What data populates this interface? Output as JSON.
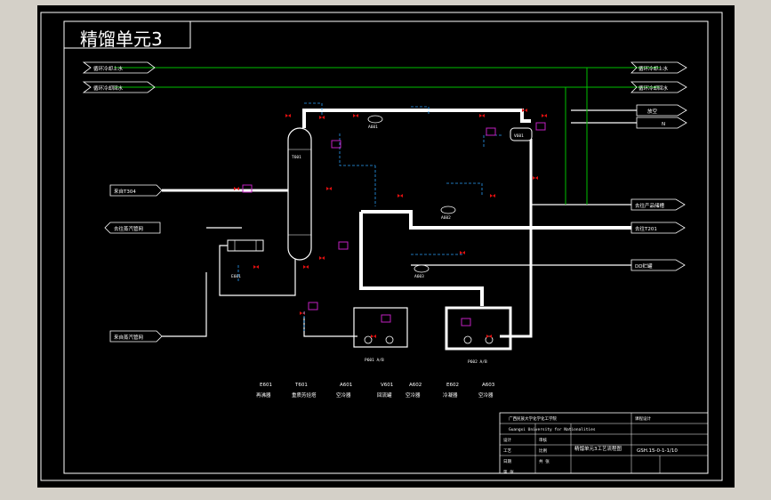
{
  "drawing": {
    "title": "精馏单元3",
    "colors": {
      "background": "#000000",
      "window_bg": "#d4d0c8",
      "frame": "#ffffff",
      "process_pipe": "#ffffff",
      "utility_line": "#00c000",
      "signal_line": "#2a9df4",
      "valve": "#e01010",
      "instrument": "#c020c0"
    }
  },
  "utility_labels": {
    "cw_supply_left": "循环冷却上水",
    "cw_return_left": "循环冷却回水",
    "cw_supply_right": "循环冷却上水",
    "cw_return_right": "循环冷却回水",
    "vent": "放空",
    "n2": "N",
    "from_t304": "来自T304",
    "to_steam_network": "去往蒸汽管网",
    "from_steam_network": "来自蒸汽管网",
    "to_product_tank": "去往产品储槽",
    "to_t201": "去往T201",
    "to_oil_tank": "DD贮罐"
  },
  "equipment_tags": {
    "column": "T601",
    "reboiler": "E601",
    "condenser": "A601",
    "accumulator": "V601",
    "cooler_a602": "A602",
    "cooler_a603": "A603",
    "pump_p601": "P601 A/B",
    "pump_p602": "P602 A/B"
  },
  "equipment_list": [
    {
      "tag": "E601",
      "name": "再沸器"
    },
    {
      "tag": "T601",
      "name": "重质芳烃塔"
    },
    {
      "tag": "A601",
      "name": "空冷器"
    },
    {
      "tag": "V601",
      "name": "回流罐"
    },
    {
      "tag": "A602",
      "name": "空冷器"
    },
    {
      "tag": "E602",
      "name": "冷凝器"
    },
    {
      "tag": "A603",
      "name": "空冷器"
    }
  ],
  "title_block": {
    "school_cn": "广西民族大学化学化工学院",
    "school_en": "Guangxi University for Nationalities",
    "project": "课程设计",
    "drawing_name": "精馏单元3工艺流程图",
    "drawing_no": "GSH.15-0-1-1/10",
    "labels": [
      "设计",
      "审核",
      "工艺",
      "比例",
      "日期",
      "共 张",
      "第 张"
    ]
  }
}
